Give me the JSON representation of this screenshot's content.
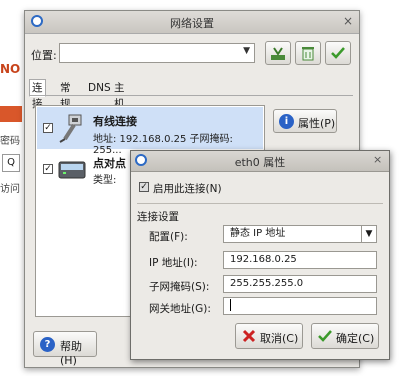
{
  "window": {
    "title": "网络设置"
  },
  "location": {
    "label": "位置:",
    "value": ""
  },
  "tabs": [
    "连接",
    "常规",
    "DNS",
    "主机"
  ],
  "connections": [
    {
      "title": "有线连接",
      "subtitle": "地址: 192.168.0.25 子网掩码: 255...",
      "checked": true
    },
    {
      "title": "点对点",
      "subtitle": "类型: ",
      "checked": true
    }
  ],
  "buttons": {
    "properties": "属性(P)",
    "help": "帮助(H)"
  },
  "dialog": {
    "title": "eth0 属性",
    "enable_label": "启用此连接(N)",
    "section_label": "连接设置",
    "config_label": "配置(F):",
    "config_value": "静态 IP 地址",
    "ip_label": "IP 地址(I):",
    "ip_value": "192.168.0.25",
    "mask_label": "子网掩码(S):",
    "mask_value": "255.255.255.0",
    "gateway_label": "网关地址(G):",
    "gateway_value": "",
    "cancel_label": "取消(C)",
    "ok_label": "确定(C)"
  },
  "background": {
    "fragment1": "NO",
    "fragment2": "密码",
    "fragment3": "Q",
    "fragment4": "访问"
  }
}
